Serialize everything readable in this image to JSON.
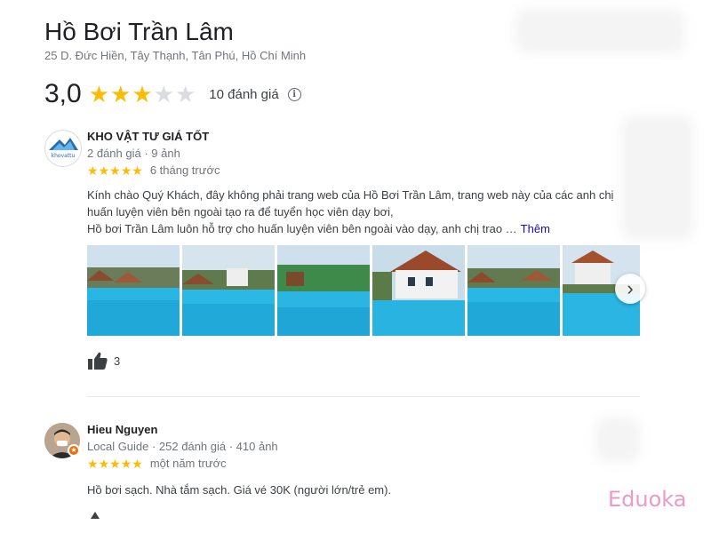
{
  "place": {
    "title": "Hồ Bơi Trần Lâm",
    "address": "25 D. Đức Hiền, Tây Thạnh, Tân Phú, Hồ Chí Minh",
    "rating_value": "3,0",
    "rating_stars": 3,
    "rating_max": 5,
    "review_count": "10 đánh giá",
    "info_icon": "info-icon"
  },
  "reviews": [
    {
      "name": "KHO VẬT TƯ GIÁ TỐT",
      "avatar_text": "khovattu",
      "avatar_icon": "khovattu-logo",
      "meta": "2 đánh giá · 9 ảnh",
      "stars": 5,
      "time": "6 tháng trước",
      "text_lines": [
        "Kính chào Quý Khách, đây không phải trang web của Hồ Bơi Trần Lâm, trang web này của các anh chị",
        "huấn luyện viên bên ngoài tạo ra để tuyển học viên dạy bơi,",
        "Hồ bơi Trần Lâm luôn hỗ trợ cho huấn luyện viên bên ngoài vào dạy, anh chị trao …"
      ],
      "more": "Thêm",
      "photo_count_visible": 6,
      "likes": "3"
    },
    {
      "name": "Hieu Nguyen",
      "avatar_icon": "user-avatar",
      "meta": "Local Guide · 252 đánh giá · 410 ảnh",
      "stars": 5,
      "time": "một năm trước",
      "text_lines": [
        "Hồ bơi sạch. Nhà tắm sạch. Giá vé 30K (người lớn/trẻ em)."
      ]
    }
  ],
  "watermark": "Eduoka",
  "colors": {
    "star_on": "#fbbc04",
    "star_off": "#dadce0",
    "link": "#1a0dab",
    "pool": "#29b6e3",
    "watermark": "#e99bc6"
  }
}
